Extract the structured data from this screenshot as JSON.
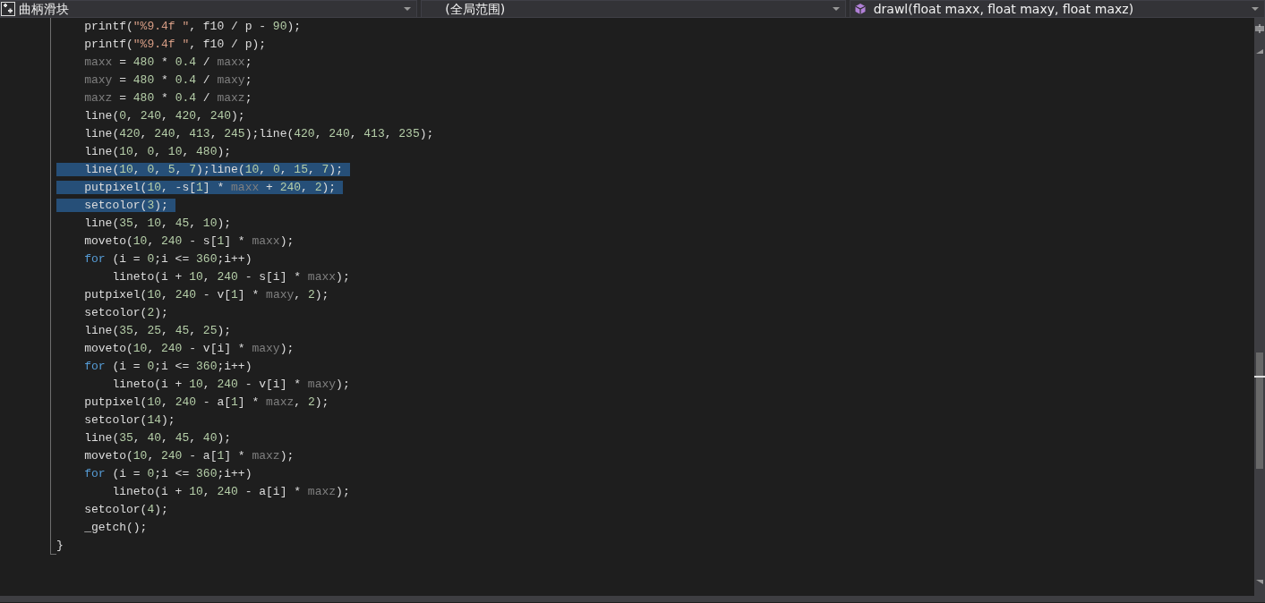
{
  "navigation_bar": {
    "project": "曲柄滑块",
    "scope": "(全局范围)",
    "member": "drawl(float maxx, float maxy, float maxz)"
  },
  "code_lines": [
    {
      "selected": false,
      "tokens": [
        {
          "text": "printf(",
          "kind": "plain"
        },
        {
          "text": "\"%9.4f \"",
          "kind": "string"
        },
        {
          "text": ", f10 / p - ",
          "kind": "plain"
        },
        {
          "text": "90",
          "kind": "number"
        },
        {
          "text": ");",
          "kind": "plain"
        }
      ]
    },
    {
      "selected": false,
      "tokens": [
        {
          "text": "printf(",
          "kind": "plain"
        },
        {
          "text": "\"%9.4f \"",
          "kind": "string"
        },
        {
          "text": ", f10 / p);",
          "kind": "plain"
        }
      ]
    },
    {
      "selected": false,
      "tokens": [
        {
          "text": "maxx",
          "kind": "param"
        },
        {
          "text": " = ",
          "kind": "plain"
        },
        {
          "text": "480",
          "kind": "number"
        },
        {
          "text": " * ",
          "kind": "plain"
        },
        {
          "text": "0.4",
          "kind": "number"
        },
        {
          "text": " / ",
          "kind": "plain"
        },
        {
          "text": "maxx",
          "kind": "param"
        },
        {
          "text": ";",
          "kind": "plain"
        }
      ]
    },
    {
      "selected": false,
      "tokens": [
        {
          "text": "maxy",
          "kind": "param"
        },
        {
          "text": " = ",
          "kind": "plain"
        },
        {
          "text": "480",
          "kind": "number"
        },
        {
          "text": " * ",
          "kind": "plain"
        },
        {
          "text": "0.4",
          "kind": "number"
        },
        {
          "text": " / ",
          "kind": "plain"
        },
        {
          "text": "maxy",
          "kind": "param"
        },
        {
          "text": ";",
          "kind": "plain"
        }
      ]
    },
    {
      "selected": false,
      "tokens": [
        {
          "text": "maxz",
          "kind": "param"
        },
        {
          "text": " = ",
          "kind": "plain"
        },
        {
          "text": "480",
          "kind": "number"
        },
        {
          "text": " * ",
          "kind": "plain"
        },
        {
          "text": "0.4",
          "kind": "number"
        },
        {
          "text": " / ",
          "kind": "plain"
        },
        {
          "text": "maxz",
          "kind": "param"
        },
        {
          "text": ";",
          "kind": "plain"
        }
      ]
    },
    {
      "selected": false,
      "tokens": [
        {
          "text": "line(",
          "kind": "plain"
        },
        {
          "text": "0",
          "kind": "number"
        },
        {
          "text": ", ",
          "kind": "plain"
        },
        {
          "text": "240",
          "kind": "number"
        },
        {
          "text": ", ",
          "kind": "plain"
        },
        {
          "text": "420",
          "kind": "number"
        },
        {
          "text": ", ",
          "kind": "plain"
        },
        {
          "text": "240",
          "kind": "number"
        },
        {
          "text": ");",
          "kind": "plain"
        }
      ]
    },
    {
      "selected": false,
      "tokens": [
        {
          "text": "line(",
          "kind": "plain"
        },
        {
          "text": "420",
          "kind": "number"
        },
        {
          "text": ", ",
          "kind": "plain"
        },
        {
          "text": "240",
          "kind": "number"
        },
        {
          "text": ", ",
          "kind": "plain"
        },
        {
          "text": "413",
          "kind": "number"
        },
        {
          "text": ", ",
          "kind": "plain"
        },
        {
          "text": "245",
          "kind": "number"
        },
        {
          "text": ");line(",
          "kind": "plain"
        },
        {
          "text": "420",
          "kind": "number"
        },
        {
          "text": ", ",
          "kind": "plain"
        },
        {
          "text": "240",
          "kind": "number"
        },
        {
          "text": ", ",
          "kind": "plain"
        },
        {
          "text": "413",
          "kind": "number"
        },
        {
          "text": ", ",
          "kind": "plain"
        },
        {
          "text": "235",
          "kind": "number"
        },
        {
          "text": ");",
          "kind": "plain"
        }
      ]
    },
    {
      "selected": false,
      "tokens": [
        {
          "text": "line(",
          "kind": "plain"
        },
        {
          "text": "10",
          "kind": "number"
        },
        {
          "text": ", ",
          "kind": "plain"
        },
        {
          "text": "0",
          "kind": "number"
        },
        {
          "text": ", ",
          "kind": "plain"
        },
        {
          "text": "10",
          "kind": "number"
        },
        {
          "text": ", ",
          "kind": "plain"
        },
        {
          "text": "480",
          "kind": "number"
        },
        {
          "text": ");",
          "kind": "plain"
        }
      ]
    },
    {
      "selected": true,
      "tokens": [
        {
          "text": "line(",
          "kind": "plain"
        },
        {
          "text": "10",
          "kind": "number"
        },
        {
          "text": ", ",
          "kind": "plain"
        },
        {
          "text": "0",
          "kind": "number"
        },
        {
          "text": ", ",
          "kind": "plain"
        },
        {
          "text": "5",
          "kind": "number"
        },
        {
          "text": ", ",
          "kind": "plain"
        },
        {
          "text": "7",
          "kind": "number"
        },
        {
          "text": ");line(",
          "kind": "plain"
        },
        {
          "text": "10",
          "kind": "number"
        },
        {
          "text": ", ",
          "kind": "plain"
        },
        {
          "text": "0",
          "kind": "number"
        },
        {
          "text": ", ",
          "kind": "plain"
        },
        {
          "text": "15",
          "kind": "number"
        },
        {
          "text": ", ",
          "kind": "plain"
        },
        {
          "text": "7",
          "kind": "number"
        },
        {
          "text": ");",
          "kind": "plain"
        }
      ]
    },
    {
      "selected": true,
      "tokens": [
        {
          "text": "putpixel(",
          "kind": "plain"
        },
        {
          "text": "10",
          "kind": "number"
        },
        {
          "text": ", -s[",
          "kind": "plain"
        },
        {
          "text": "1",
          "kind": "number"
        },
        {
          "text": "] * ",
          "kind": "plain"
        },
        {
          "text": "maxx",
          "kind": "param"
        },
        {
          "text": " + ",
          "kind": "plain"
        },
        {
          "text": "240",
          "kind": "number"
        },
        {
          "text": ", ",
          "kind": "plain"
        },
        {
          "text": "2",
          "kind": "number"
        },
        {
          "text": ");",
          "kind": "plain"
        }
      ]
    },
    {
      "selected": true,
      "tokens": [
        {
          "text": "setcolor(",
          "kind": "plain"
        },
        {
          "text": "3",
          "kind": "number"
        },
        {
          "text": ");",
          "kind": "plain"
        }
      ]
    },
    {
      "selected": false,
      "tokens": [
        {
          "text": "line(",
          "kind": "plain"
        },
        {
          "text": "35",
          "kind": "number"
        },
        {
          "text": ", ",
          "kind": "plain"
        },
        {
          "text": "10",
          "kind": "number"
        },
        {
          "text": ", ",
          "kind": "plain"
        },
        {
          "text": "45",
          "kind": "number"
        },
        {
          "text": ", ",
          "kind": "plain"
        },
        {
          "text": "10",
          "kind": "number"
        },
        {
          "text": ");",
          "kind": "plain"
        }
      ]
    },
    {
      "selected": false,
      "tokens": [
        {
          "text": "moveto(",
          "kind": "plain"
        },
        {
          "text": "10",
          "kind": "number"
        },
        {
          "text": ", ",
          "kind": "plain"
        },
        {
          "text": "240",
          "kind": "number"
        },
        {
          "text": " - s[",
          "kind": "plain"
        },
        {
          "text": "1",
          "kind": "number"
        },
        {
          "text": "] * ",
          "kind": "plain"
        },
        {
          "text": "maxx",
          "kind": "param"
        },
        {
          "text": ");",
          "kind": "plain"
        }
      ]
    },
    {
      "selected": false,
      "tokens": [
        {
          "text": "for",
          "kind": "keyword"
        },
        {
          "text": " (i = ",
          "kind": "plain"
        },
        {
          "text": "0",
          "kind": "number"
        },
        {
          "text": ";i <= ",
          "kind": "plain"
        },
        {
          "text": "360",
          "kind": "number"
        },
        {
          "text": ";i++)",
          "kind": "plain"
        }
      ],
      "children": [
        {
          "selected": false,
          "tokens": [
            {
              "text": "lineto(i + ",
              "kind": "plain"
            },
            {
              "text": "10",
              "kind": "number"
            },
            {
              "text": ", ",
              "kind": "plain"
            },
            {
              "text": "240",
              "kind": "number"
            },
            {
              "text": " - s[i] * ",
              "kind": "plain"
            },
            {
              "text": "maxx",
              "kind": "param"
            },
            {
              "text": ");",
              "kind": "plain"
            }
          ]
        }
      ]
    },
    {
      "selected": false,
      "tokens": [
        {
          "text": "putpixel(",
          "kind": "plain"
        },
        {
          "text": "10",
          "kind": "number"
        },
        {
          "text": ", ",
          "kind": "plain"
        },
        {
          "text": "240",
          "kind": "number"
        },
        {
          "text": " - v[",
          "kind": "plain"
        },
        {
          "text": "1",
          "kind": "number"
        },
        {
          "text": "] * ",
          "kind": "plain"
        },
        {
          "text": "maxy",
          "kind": "param"
        },
        {
          "text": ", ",
          "kind": "plain"
        },
        {
          "text": "2",
          "kind": "number"
        },
        {
          "text": ");",
          "kind": "plain"
        }
      ]
    },
    {
      "selected": false,
      "tokens": [
        {
          "text": "setcolor(",
          "kind": "plain"
        },
        {
          "text": "2",
          "kind": "number"
        },
        {
          "text": ");",
          "kind": "plain"
        }
      ]
    },
    {
      "selected": false,
      "tokens": [
        {
          "text": "line(",
          "kind": "plain"
        },
        {
          "text": "35",
          "kind": "number"
        },
        {
          "text": ", ",
          "kind": "plain"
        },
        {
          "text": "25",
          "kind": "number"
        },
        {
          "text": ", ",
          "kind": "plain"
        },
        {
          "text": "45",
          "kind": "number"
        },
        {
          "text": ", ",
          "kind": "plain"
        },
        {
          "text": "25",
          "kind": "number"
        },
        {
          "text": ");",
          "kind": "plain"
        }
      ]
    },
    {
      "selected": false,
      "tokens": [
        {
          "text": "moveto(",
          "kind": "plain"
        },
        {
          "text": "10",
          "kind": "number"
        },
        {
          "text": ", ",
          "kind": "plain"
        },
        {
          "text": "240",
          "kind": "number"
        },
        {
          "text": " - v[i] * ",
          "kind": "plain"
        },
        {
          "text": "maxy",
          "kind": "param"
        },
        {
          "text": ");",
          "kind": "plain"
        }
      ]
    },
    {
      "selected": false,
      "tokens": [
        {
          "text": "for",
          "kind": "keyword"
        },
        {
          "text": " (i = ",
          "kind": "plain"
        },
        {
          "text": "0",
          "kind": "number"
        },
        {
          "text": ";i <= ",
          "kind": "plain"
        },
        {
          "text": "360",
          "kind": "number"
        },
        {
          "text": ";i++)",
          "kind": "plain"
        }
      ],
      "children": [
        {
          "selected": false,
          "tokens": [
            {
              "text": "lineto(i + ",
              "kind": "plain"
            },
            {
              "text": "10",
              "kind": "number"
            },
            {
              "text": ", ",
              "kind": "plain"
            },
            {
              "text": "240",
              "kind": "number"
            },
            {
              "text": " - v[i] * ",
              "kind": "plain"
            },
            {
              "text": "maxy",
              "kind": "param"
            },
            {
              "text": ");",
              "kind": "plain"
            }
          ]
        }
      ]
    },
    {
      "selected": false,
      "tokens": [
        {
          "text": "putpixel(",
          "kind": "plain"
        },
        {
          "text": "10",
          "kind": "number"
        },
        {
          "text": ", ",
          "kind": "plain"
        },
        {
          "text": "240",
          "kind": "number"
        },
        {
          "text": " - a[",
          "kind": "plain"
        },
        {
          "text": "1",
          "kind": "number"
        },
        {
          "text": "] * ",
          "kind": "plain"
        },
        {
          "text": "maxz",
          "kind": "param"
        },
        {
          "text": ", ",
          "kind": "plain"
        },
        {
          "text": "2",
          "kind": "number"
        },
        {
          "text": ");",
          "kind": "plain"
        }
      ]
    },
    {
      "selected": false,
      "tokens": [
        {
          "text": "setcolor(",
          "kind": "plain"
        },
        {
          "text": "14",
          "kind": "number"
        },
        {
          "text": ");",
          "kind": "plain"
        }
      ]
    },
    {
      "selected": false,
      "tokens": [
        {
          "text": "line(",
          "kind": "plain"
        },
        {
          "text": "35",
          "kind": "number"
        },
        {
          "text": ", ",
          "kind": "plain"
        },
        {
          "text": "40",
          "kind": "number"
        },
        {
          "text": ", ",
          "kind": "plain"
        },
        {
          "text": "45",
          "kind": "number"
        },
        {
          "text": ", ",
          "kind": "plain"
        },
        {
          "text": "40",
          "kind": "number"
        },
        {
          "text": ");",
          "kind": "plain"
        }
      ]
    },
    {
      "selected": false,
      "tokens": [
        {
          "text": "moveto(",
          "kind": "plain"
        },
        {
          "text": "10",
          "kind": "number"
        },
        {
          "text": ", ",
          "kind": "plain"
        },
        {
          "text": "240",
          "kind": "number"
        },
        {
          "text": " - a[",
          "kind": "plain"
        },
        {
          "text": "1",
          "kind": "number"
        },
        {
          "text": "] * ",
          "kind": "plain"
        },
        {
          "text": "maxz",
          "kind": "param"
        },
        {
          "text": ");",
          "kind": "plain"
        }
      ]
    },
    {
      "selected": false,
      "tokens": [
        {
          "text": "for",
          "kind": "keyword"
        },
        {
          "text": " (i = ",
          "kind": "plain"
        },
        {
          "text": "0",
          "kind": "number"
        },
        {
          "text": ";i <= ",
          "kind": "plain"
        },
        {
          "text": "360",
          "kind": "number"
        },
        {
          "text": ";i++)",
          "kind": "plain"
        }
      ],
      "children": [
        {
          "selected": false,
          "tokens": [
            {
              "text": "lineto(i + ",
              "kind": "plain"
            },
            {
              "text": "10",
              "kind": "number"
            },
            {
              "text": ", ",
              "kind": "plain"
            },
            {
              "text": "240",
              "kind": "number"
            },
            {
              "text": " - a[i] * ",
              "kind": "plain"
            },
            {
              "text": "maxz",
              "kind": "param"
            },
            {
              "text": ");",
              "kind": "plain"
            }
          ]
        }
      ]
    },
    {
      "selected": false,
      "tokens": [
        {
          "text": "setcolor(",
          "kind": "plain"
        },
        {
          "text": "4",
          "kind": "number"
        },
        {
          "text": ");",
          "kind": "plain"
        }
      ]
    },
    {
      "selected": false,
      "tokens": [
        {
          "text": "_getch();",
          "kind": "plain"
        }
      ]
    }
  ],
  "closing_brace": "}"
}
